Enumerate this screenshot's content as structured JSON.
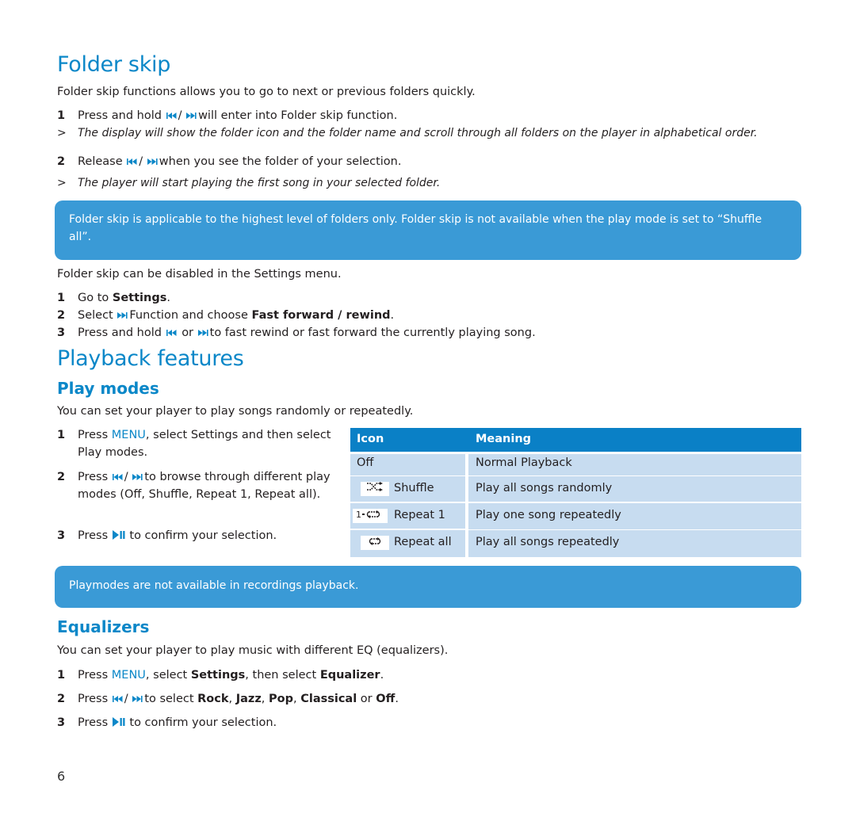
{
  "folder_skip": {
    "title": "Folder skip",
    "intro": "Folder skip functions allows you to go to next or previous folders quickly.",
    "step1": {
      "num": "1",
      "prefix": "Press and hold",
      "sep": "/",
      "suffix": "will enter into Folder skip function."
    },
    "result1": {
      "marker": ">",
      "text": "The display will show the folder icon and the folder name and scroll through all folders on the player in alphabetical order."
    },
    "step2": {
      "num": "2",
      "prefix": "Release",
      "sep": "/",
      "suffix": "when you see the folder of your selection."
    },
    "result2": {
      "marker": ">",
      "text": "The player will start playing the first song in your selected folder."
    },
    "note": "Folder skip is applicable to the highest level of folders only. Folder skip is not available when the play mode is set to “Shuffle all”.",
    "disable_text": "Folder skip can be disabled in the Settings menu.",
    "disable_steps": [
      {
        "num": "1",
        "prefix": "Go to",
        "bold": "Settings",
        "suffix": "."
      },
      {
        "num": "2",
        "prefix": "Select",
        "middle": "Function and choose",
        "bold": "Fast forward / rewind",
        "suffix": "."
      },
      {
        "num": "3",
        "prefix": "Press and hold",
        "or": "or",
        "suffix": "to fast rewind or fast forward the currently playing song."
      }
    ]
  },
  "playback": {
    "title": "Playback features",
    "play_modes": {
      "title": "Play modes",
      "intro": "You can set your player to play songs randomly or repeatedly.",
      "steps": [
        {
          "num": "1",
          "prefix": "Press",
          "menu": "MENU",
          "suffix": ", select Settings and then select Play modes."
        },
        {
          "num": "2",
          "prefix": "Press",
          "sep": "/",
          "suffix": "to browse through different play modes (Off, Shuffle, Repeat 1, Repeat all)."
        },
        {
          "num": "3",
          "prefix": "Press",
          "suffix": "to confirm your selection."
        }
      ],
      "table": {
        "headers": [
          "Icon",
          "Meaning"
        ],
        "rows": [
          {
            "icon": "",
            "label": "Off",
            "meaning": "Normal Playback"
          },
          {
            "icon": "shuffle-icon",
            "label": "Shuffle",
            "meaning": "Play all songs randomly"
          },
          {
            "icon": "repeat-one-icon",
            "label": "Repeat 1",
            "meaning": "Play one song repeatedly"
          },
          {
            "icon": "repeat-all-icon",
            "label": "Repeat all",
            "meaning": "Play all songs repeatedly"
          }
        ]
      },
      "note": "Playmodes are not available in recordings playback."
    },
    "equalizers": {
      "title": "Equalizers",
      "intro": "You can set your player to play music with different EQ (equalizers).",
      "steps": [
        {
          "num": "1",
          "prefix": "Press",
          "menu": "MENU",
          "mid1": ", select",
          "bold1": "Settings",
          "mid2": ", then select",
          "bold2": "Equalizer",
          "suffix": "."
        },
        {
          "num": "2",
          "prefix": "Press",
          "sep": "/",
          "mid": "to select",
          "options": [
            "Rock",
            "Jazz",
            "Pop",
            "Classical"
          ],
          "or": "or",
          "last": "Off",
          "suffix": "."
        },
        {
          "num": "3",
          "prefix": "Press",
          "suffix": "to confirm your selection."
        }
      ]
    }
  },
  "colors": {
    "accent": "#0a87c8",
    "note_bg": "#3a9ad6",
    "table_header": "#0a80c6",
    "table_cell": "#c7dcf0"
  },
  "page_number": "6"
}
